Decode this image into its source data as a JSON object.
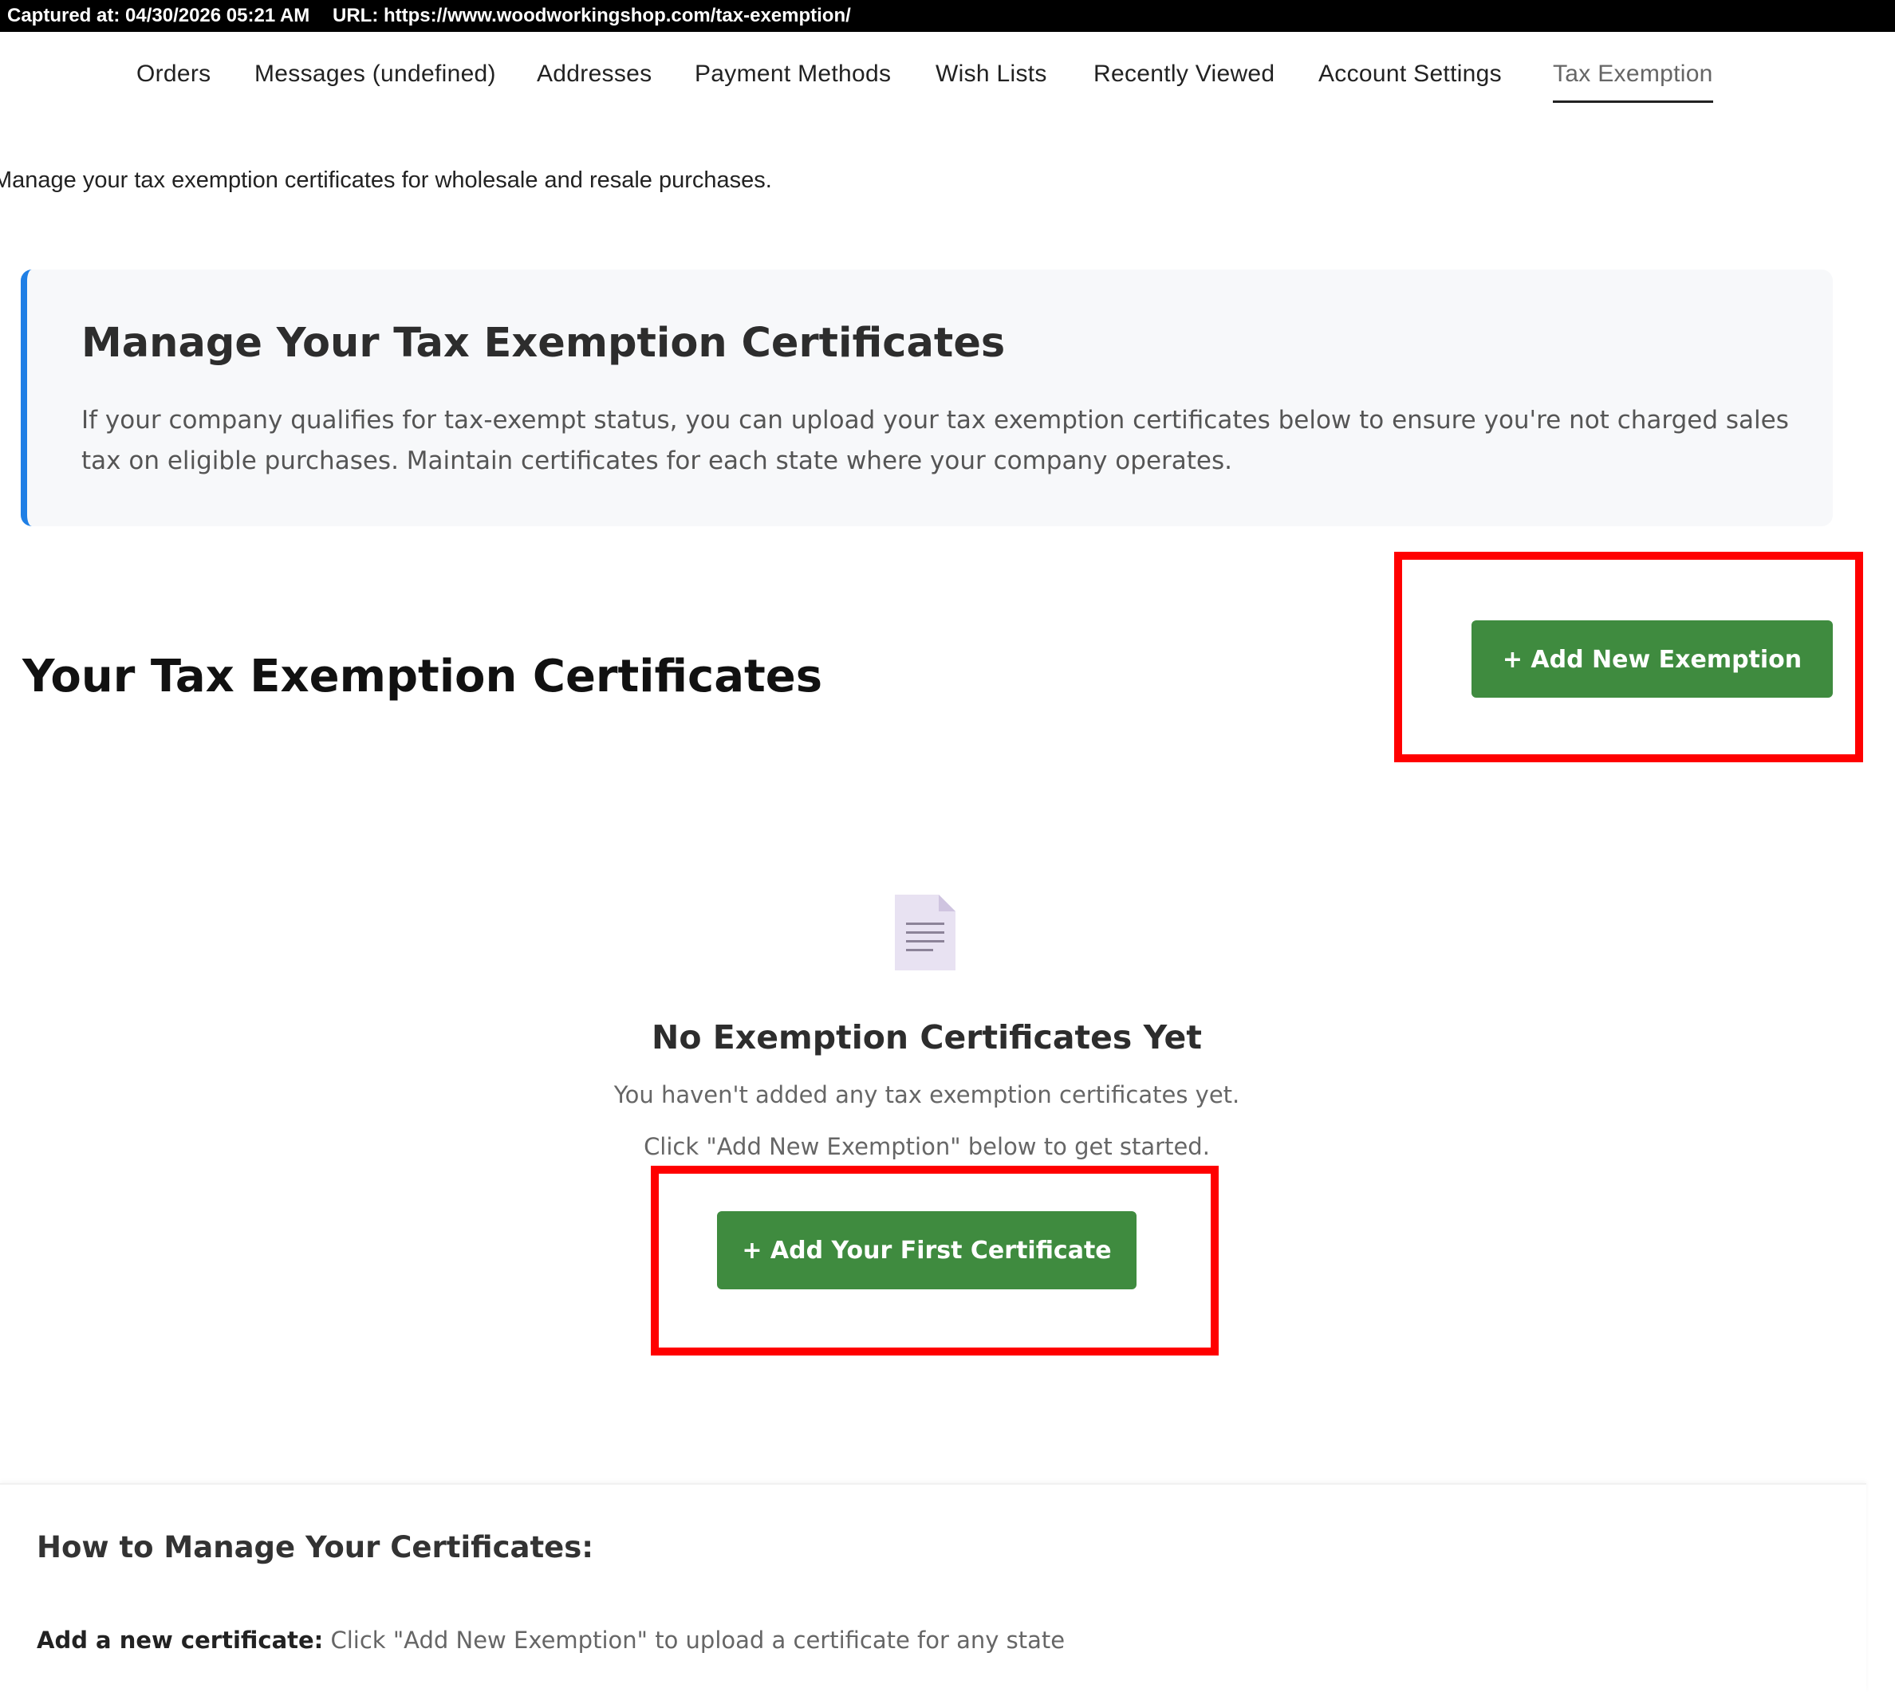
{
  "capture": {
    "time": "Captured at: 04/30/2026 05:21 AM",
    "url": "URL: https://www.woodworkingshop.com/tax-exemption/"
  },
  "nav": {
    "items": [
      {
        "label": "Orders"
      },
      {
        "label": "Messages (undefined)"
      },
      {
        "label": "Addresses"
      },
      {
        "label": "Payment Methods"
      },
      {
        "label": "Wish Lists"
      },
      {
        "label": "Recently Viewed"
      },
      {
        "label": "Account Settings"
      },
      {
        "label": "Tax Exemption",
        "active": true
      }
    ]
  },
  "intro": {
    "text": "Manage your tax exemption certificates for wholesale and resale purchases."
  },
  "info_card": {
    "title": "Manage Your Tax Exemption Certificates",
    "body": "If your company qualifies for tax-exempt status, you can upload your tax exemption certificates below to ensure you're not charged sales tax on eligible purchases. Maintain certificates for each state where your company operates."
  },
  "certificates": {
    "title": "Your Tax Exemption Certificates",
    "add_button": "+ Add New Exemption"
  },
  "empty_state": {
    "icon": "document-icon",
    "title": "No Exemption Certificates Yet",
    "line1": "You haven't added any tax exemption certificates yet.",
    "line2": "Click \"Add New Exemption\" below to get started.",
    "button": "+ Add Your First Certificate"
  },
  "howto": {
    "title": "How to Manage Your Certificates:",
    "items": [
      {
        "label": "Add a new certificate:",
        "text": "Click \"Add New Exemption\" to upload a certificate for any state"
      }
    ]
  },
  "colors": {
    "accent_blue": "#1f7fe5",
    "button_green": "#3f8b3f",
    "highlight_red": "#ff0000"
  }
}
